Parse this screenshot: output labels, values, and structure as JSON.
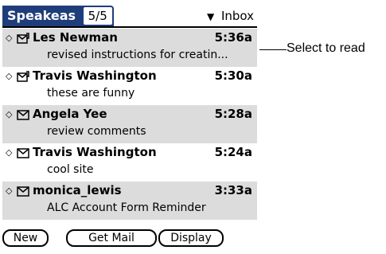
{
  "app": {
    "title": "Speakeas",
    "count": "5/5",
    "folder": "Inbox"
  },
  "messages": [
    {
      "sender": "Les Newman",
      "time": "5:36a",
      "subject": "revised instructions for creatin...",
      "icon": "flagged-envelope-icon"
    },
    {
      "sender": "Travis Washington",
      "time": "5:30a",
      "subject": "these are funny",
      "icon": "flagged-envelope-icon"
    },
    {
      "sender": "Angela Yee",
      "time": "5:28a",
      "subject": "review comments",
      "icon": "envelope-icon"
    },
    {
      "sender": "Travis Washington",
      "time": "5:24a",
      "subject": "cool site",
      "icon": "envelope-icon"
    },
    {
      "sender": "monica_lewis",
      "time": "3:33a",
      "subject": "ALC Account Form Reminder",
      "icon": "envelope-icon"
    }
  ],
  "buttons": {
    "new": "New",
    "get_mail": "Get Mail",
    "display": "Display"
  },
  "callout": "Select to read",
  "colors": {
    "title_bg": "#1f3d7a",
    "row_shade": "#dcdcdc"
  }
}
